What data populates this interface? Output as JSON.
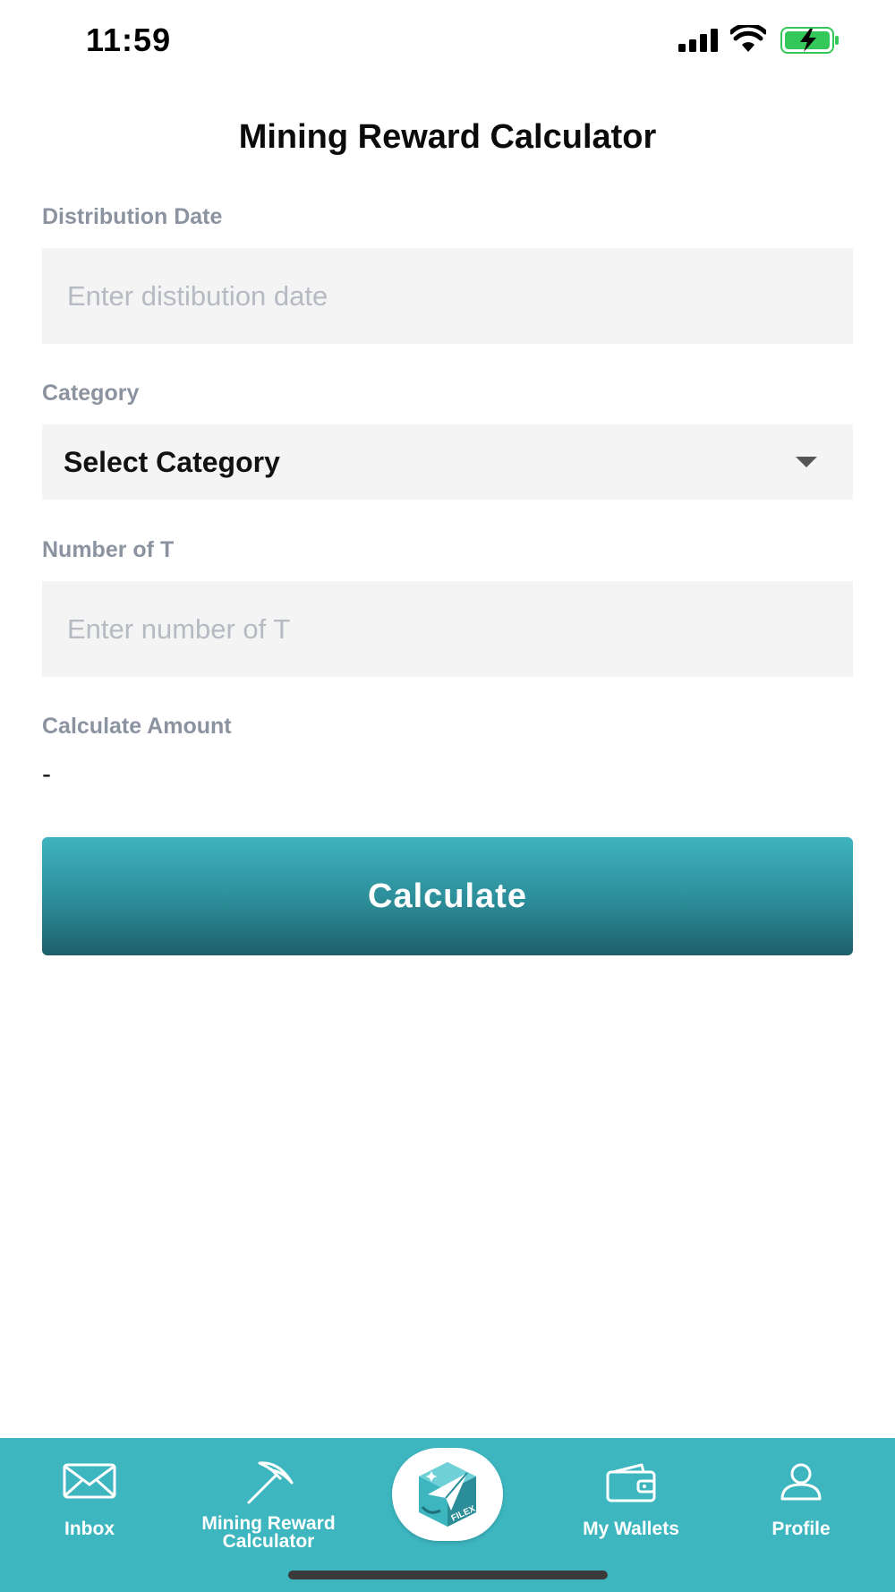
{
  "status_bar": {
    "time": "11:59"
  },
  "header": {
    "title": "Mining Reward Calculator"
  },
  "form": {
    "distribution_date": {
      "label": "Distribution Date",
      "placeholder": "Enter distibution date",
      "value": ""
    },
    "category": {
      "label": "Category",
      "selected": "Select Category"
    },
    "number_of_t": {
      "label": "Number of T",
      "placeholder": "Enter number of T",
      "value": ""
    },
    "calculate_amount": {
      "label": "Calculate Amount",
      "value": "-"
    },
    "calculate_button": "Calculate"
  },
  "tab_bar": {
    "items": [
      {
        "label": "Inbox",
        "icon": "envelope-icon"
      },
      {
        "label": "Mining Reward Calculator",
        "icon": "pickaxe-icon"
      },
      {
        "label": "",
        "icon": "filex-logo"
      },
      {
        "label": "My Wallets",
        "icon": "wallet-icon"
      },
      {
        "label": "Profile",
        "icon": "person-icon"
      }
    ]
  },
  "colors": {
    "accent": "#3db6bf",
    "button_top": "#3fb3bf",
    "button_bottom": "#1e5f6a",
    "label": "#8b93a0",
    "input_bg": "#f4f4f5",
    "battery_green": "#34c759"
  }
}
